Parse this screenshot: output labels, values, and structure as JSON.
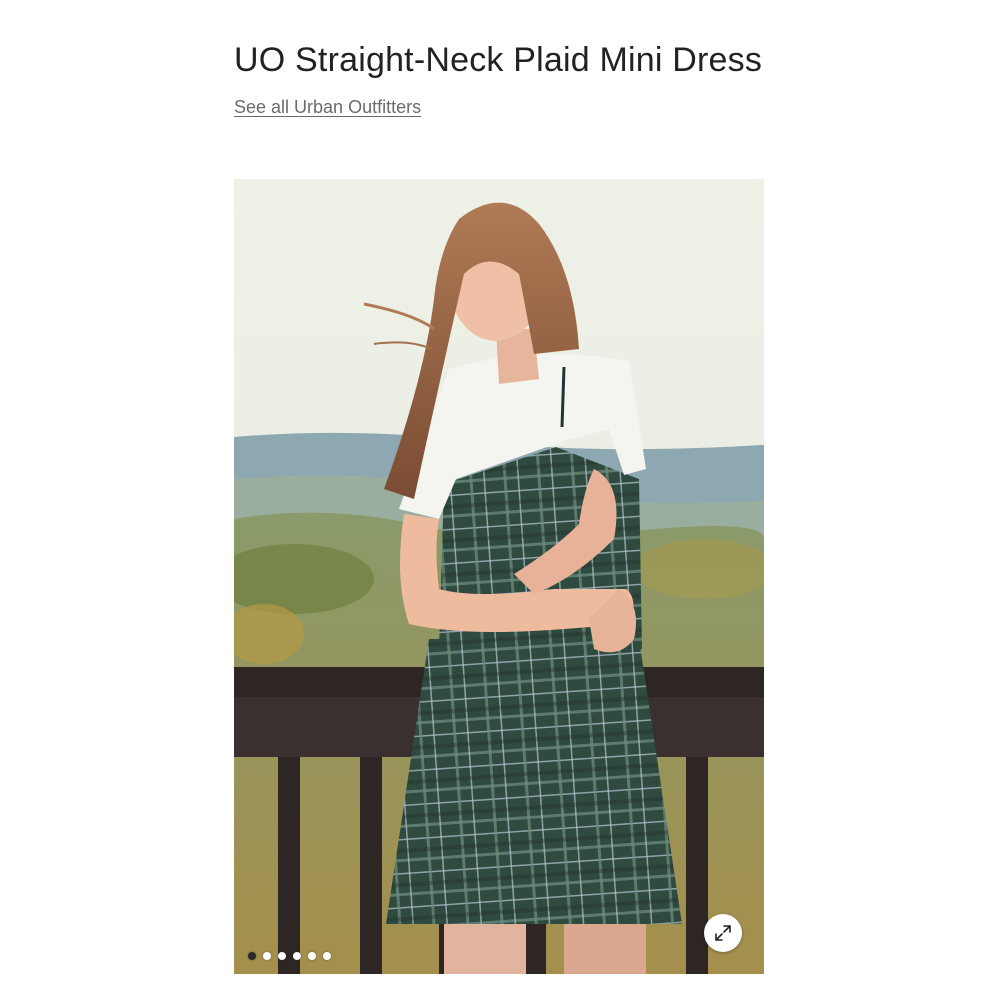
{
  "product": {
    "title": "UO Straight-Neck Plaid Mini Dress",
    "brand_link": "See all Urban Outfitters"
  },
  "gallery": {
    "image_alt": "Model wearing plaid mini dress over white t-shirt",
    "slide_count": 6,
    "active_slide": 1,
    "zoom_icon": "expand-arrows-icon"
  },
  "colors": {
    "title_text": "#222222",
    "link_text": "#6b6b6b",
    "dress_plaid": "#2f4a3e"
  }
}
